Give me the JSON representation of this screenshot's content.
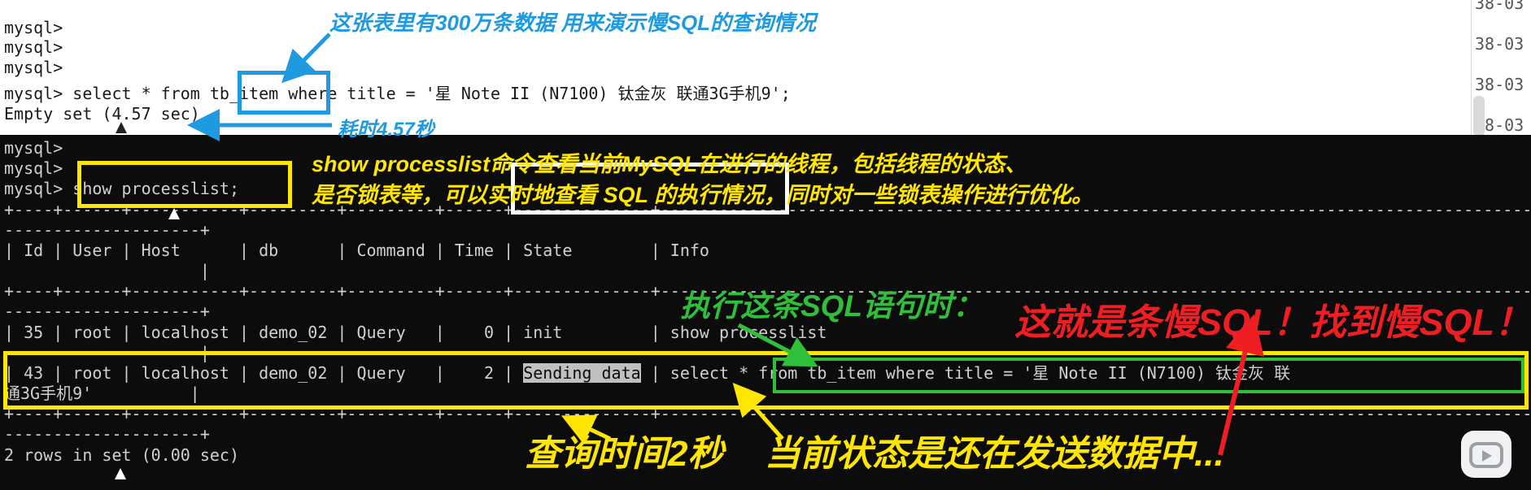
{
  "top_terminal": {
    "lines": [
      "mysql>",
      "mysql>",
      "mysql>",
      "mysql> select * from tb_item where title = '星 Note II (N7100) 钛金灰 联通3G手机9';",
      "Empty set (4.57 sec)"
    ],
    "side_dates": [
      "38-03",
      "38-03",
      "38-03",
      "38-03",
      "38-03"
    ]
  },
  "bottom_terminal": {
    "lines": [
      "mysql>",
      "mysql>",
      "mysql> show processlist;",
      "+----+------+-----------+---------+---------+------+--------------+-------------------------------------------------------------------------------------------------------------------",
      "--------------------+",
      "| Id | User | Host      | db      | Command | Time | State        | Info",
      "                    |",
      "+----+------+-----------+---------+---------+------+--------------+-------------------------------------------------------------------------------------------------------------------",
      "--------------------+",
      "| 35 | root | localhost | demo_02 | Query   |    0 | init         | show processlist",
      "                    |",
      "| 43 | root | localhost | demo_02 | Query   |    2 | ",
      "通3G手机9'          |",
      "+----+------+-----------+---------+---------+------+--------------+-------------------------------------------------------------------------------------------------------------------",
      "--------------------+",
      "2 rows in set (0.00 sec)"
    ],
    "row43_state": "Sending data",
    "row43_info": " | select * from tb_item where title = '星 Note II (N7100) 钛金灰 联"
  },
  "annotations": {
    "table_note": "这张表里有300万条数据   用来演示慢SQL的查询情况",
    "time_note": "耗时4.57秒",
    "processlist_note_1": "show processlist命令查看当前MySQL在进行的线程，包括线程的状态、",
    "processlist_note_2": "是否锁表等，可以实时地查看 SQL 的执行情况，同时对一些锁表操作进行优化。",
    "exec_note": "执行这条SQL语句时：",
    "slow_sql_note": "这就是条慢SQL！找到慢SQL！",
    "query_time_note": "查询时间2秒",
    "state_note": "当前状态是还在发送数据中..."
  },
  "colors": {
    "blue": "#1e9ae0",
    "yellow": "#ffe600",
    "green": "#2fbf3a",
    "red": "#f01e23",
    "white": "#ffffff"
  }
}
